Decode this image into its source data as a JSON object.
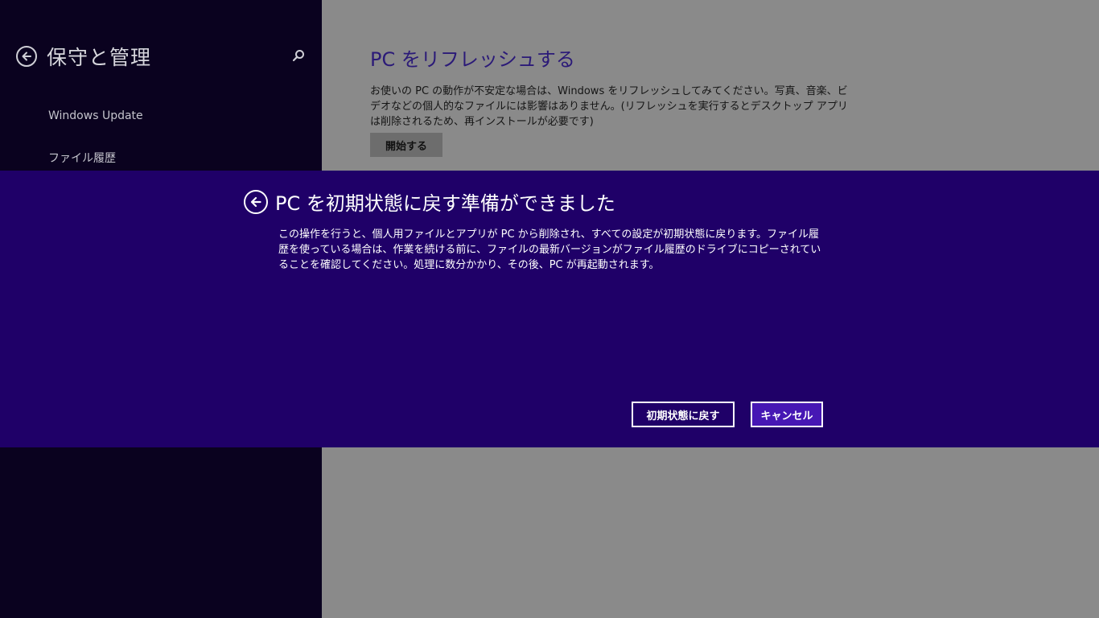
{
  "left_pane": {
    "title": "保守と管理",
    "back_icon": "back-arrow-icon",
    "search_icon": "search-icon",
    "nav_items": [
      {
        "label": "Windows Update"
      },
      {
        "label": "ファイル履歴"
      }
    ]
  },
  "right_pane": {
    "refresh_title": "PC をリフレッシュする",
    "refresh_description": "お使いの PC の動作が不安定な場合は、Windows をリフレッシュしてみてください。写真、音楽、ビデオなどの個人的なファイルには影響はありません。(リフレッシュを実行するとデスクトップ アプリは削除されるため、再インストールが必要です)",
    "start_button": "開始する"
  },
  "dialog": {
    "title": "PC を初期状態に戻す準備ができました",
    "description": "この操作を行うと、個人用ファイルとアプリが PC から削除され、すべての設定が初期状態に戻ります。ファイル履歴を使っている場合は、作業を続ける前に、ファイルの最新バージョンがファイル履歴のドライブにコピーされていることを確認してください。処理に数分かかり、その後、PC が再起動されます。",
    "reset_button": "初期状態に戻す",
    "cancel_button": "キャンセル"
  },
  "colors": {
    "left_pane_bg": "#0a021f",
    "right_pane_bg": "#8a8a8a",
    "dialog_bg": "#1f0068",
    "accent_title": "#2b1a78",
    "cancel_bg": "#4617b4"
  }
}
